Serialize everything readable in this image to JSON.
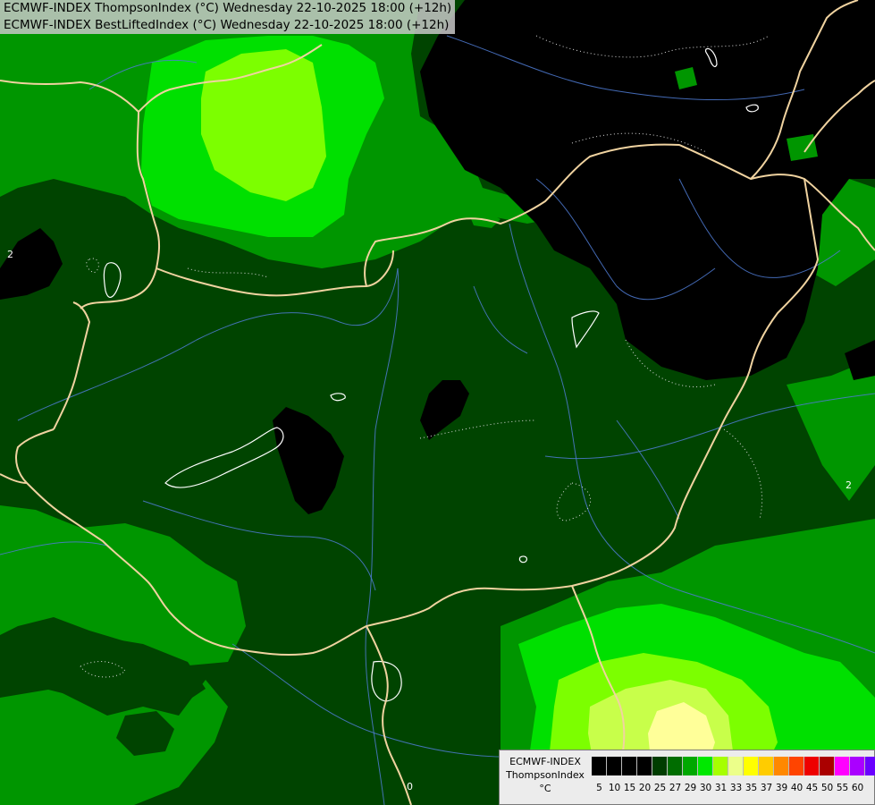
{
  "header": {
    "line1": "ECMWF-INDEX ThompsonIndex (°C) Wednesday 22-10-2025 18:00 (+12h)",
    "line2": "ECMWF-INDEX BestLiftedIndex (°C) Wednesday 22-10-2025 18:00 (+12h)"
  },
  "map": {
    "contour_labels": [
      "2",
      "2",
      "0"
    ]
  },
  "legend": {
    "title_line1": "ECMWF-INDEX",
    "title_line2": "ThompsonIndex",
    "unit": "°C",
    "ticks": [
      "5",
      "10",
      "15",
      "20",
      "25",
      "27",
      "29",
      "30",
      "31",
      "33",
      "35",
      "37",
      "39",
      "40",
      "45",
      "50",
      "55",
      "60"
    ],
    "colors": [
      "#000000",
      "#000000",
      "#000000",
      "#000000",
      "#003d00",
      "#006d00",
      "#00a800",
      "#00e800",
      "#a6ff00",
      "#ecff8a",
      "#ffff00",
      "#ffcc00",
      "#ff8800",
      "#ff4400",
      "#ee0000",
      "#aa0000",
      "#ff00ff",
      "#aa00ff",
      "#6a00ff",
      "#0000ff"
    ]
  },
  "colors": {
    "background_green": "#004400",
    "border_line": "#f0d3a0",
    "river_line": "#4f7bd4",
    "contour_line": "#ffffff"
  }
}
